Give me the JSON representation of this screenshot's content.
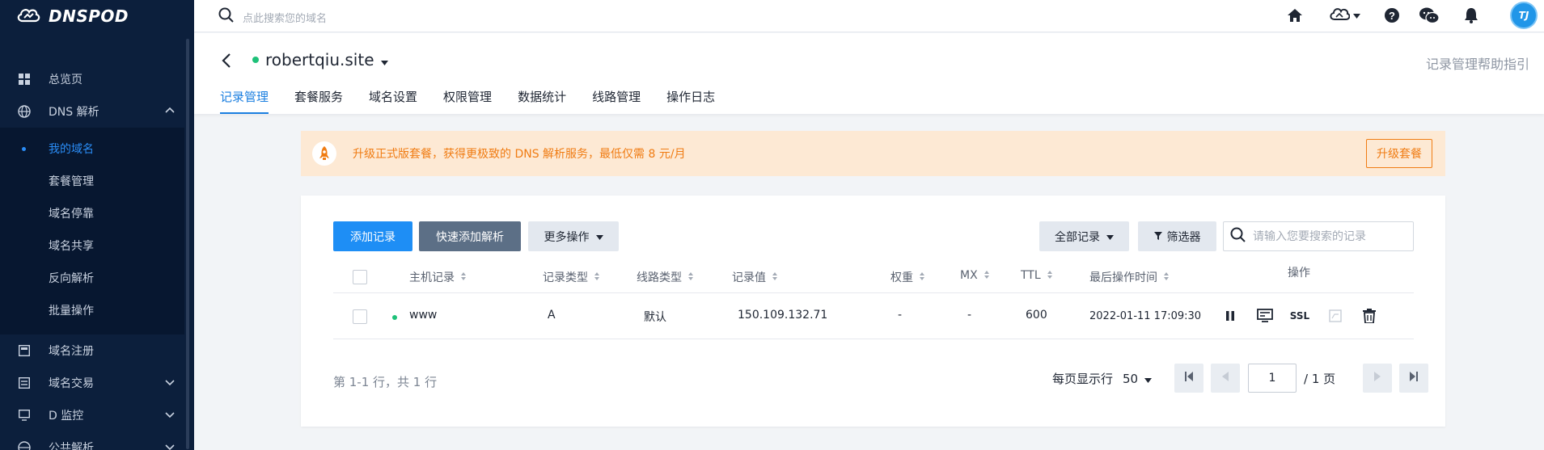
{
  "app": {
    "logo_text": "DNSPOD"
  },
  "sidebar": {
    "items": [
      {
        "label": "总览页",
        "icon": "grid-icon"
      },
      {
        "label": "DNS 解析",
        "icon": "globe-icon",
        "expanded": true
      },
      {
        "label": "域名注册",
        "icon": "register-icon"
      },
      {
        "label": "域名交易",
        "icon": "trade-icon"
      },
      {
        "label": "D 监控",
        "icon": "monitor-icon"
      },
      {
        "label": "公共解析",
        "icon": "globe-icon"
      }
    ],
    "dns_submenu": [
      {
        "label": "我的域名",
        "active": true
      },
      {
        "label": "套餐管理"
      },
      {
        "label": "域名停靠"
      },
      {
        "label": "域名共享"
      },
      {
        "label": "反向解析"
      },
      {
        "label": "批量操作"
      }
    ]
  },
  "topbar": {
    "search_placeholder": "点此搜索您的域名",
    "avatar_text": "TJ"
  },
  "domain": {
    "name": "robertqiu.site",
    "status_color": "#1ec179",
    "help_link": "记录管理帮助指引",
    "tabs": [
      {
        "label": "记录管理",
        "active": true
      },
      {
        "label": "套餐服务"
      },
      {
        "label": "域名设置"
      },
      {
        "label": "权限管理"
      },
      {
        "label": "数据统计"
      },
      {
        "label": "线路管理"
      },
      {
        "label": "操作日志"
      }
    ]
  },
  "banner": {
    "text": "升级正式版套餐，获得更极致的 DNS 解析服务，最低仅需 8 元/月",
    "button": "升级套餐",
    "color": "#f07c13"
  },
  "toolbar": {
    "add_record": "添加记录",
    "quick_add": "快速添加解析",
    "more_ops": "更多操作",
    "all_records": "全部记录",
    "filter": "筛选器",
    "search_placeholder": "请输入您要搜索的记录"
  },
  "table": {
    "headers": {
      "host": "主机记录",
      "type": "记录类型",
      "line": "线路类型",
      "value": "记录值",
      "weight": "权重",
      "mx": "MX",
      "ttl": "TTL",
      "updated": "最后操作时间",
      "actions": "操作"
    },
    "rows": [
      {
        "host": "www",
        "type": "A",
        "line": "默认",
        "value": "150.109.132.71",
        "weight": "-",
        "mx": "-",
        "ttl": "600",
        "updated": "2022-01-11 17:09:30",
        "ssl_label": "SSL"
      }
    ]
  },
  "pagination": {
    "summary": "第 1-1 行，共 1 行",
    "per_page_label": "每页显示行",
    "per_page_value": "50",
    "current_page": "1",
    "total_pages": "/ 1 页"
  },
  "colors": {
    "primary": "#1e8ef5",
    "sidebar_bg": "#0c1f3c",
    "success": "#1ec179"
  }
}
